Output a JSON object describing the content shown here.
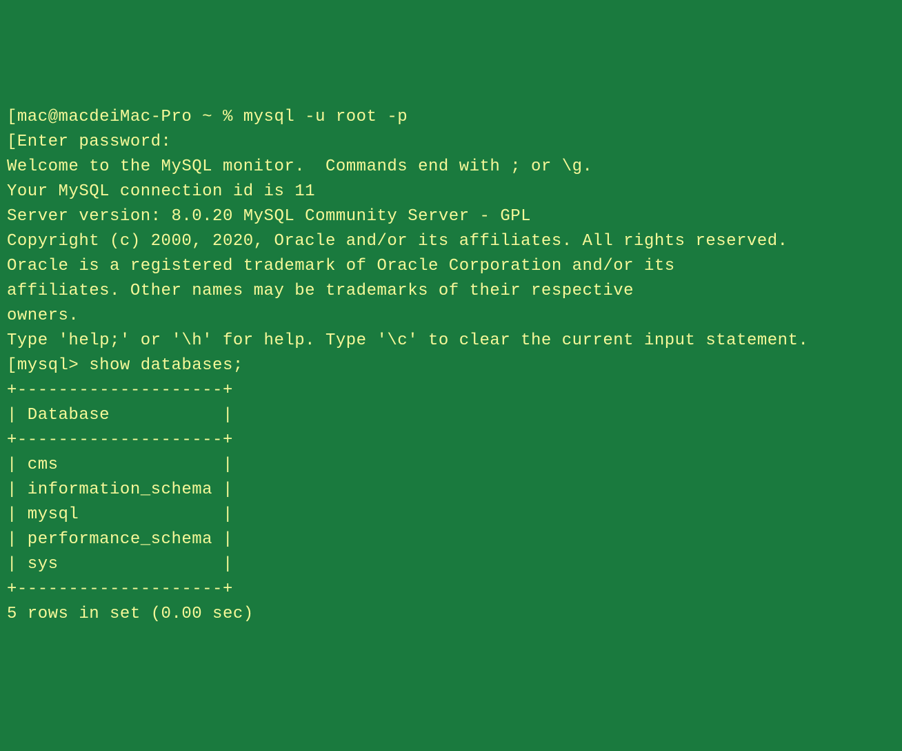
{
  "terminal": {
    "prompt1": "[mac@macdeiMac-Pro ~ % mysql -u root -p",
    "enter_password": "[Enter password:",
    "welcome": "Welcome to the MySQL monitor.  Commands end with ; or \\g.",
    "conn_id": "Your MySQL connection id is 11",
    "server_version": "Server version: 8.0.20 MySQL Community Server - GPL",
    "blank1": "",
    "copyright": "Copyright (c) 2000, 2020, Oracle and/or its affiliates. All rights reserved.",
    "blank2": "",
    "trademark1": "Oracle is a registered trademark of Oracle Corporation and/or its",
    "trademark2": "affiliates. Other names may be trademarks of their respective",
    "trademark3": "owners.",
    "blank3": "",
    "help": "Type 'help;' or '\\h' for help. Type '\\c' to clear the current input statement.",
    "blank4": "",
    "prompt2": "[mysql> show databases;",
    "table_top": "+--------------------+",
    "table_header": "| Database           |",
    "table_sep": "+--------------------+",
    "row1": "| cms                |",
    "row2": "| information_schema |",
    "row3": "| mysql              |",
    "row4": "| performance_schema |",
    "row5": "| sys                |",
    "table_bottom": "+--------------------+",
    "result": "5 rows in set (0.00 sec)"
  }
}
